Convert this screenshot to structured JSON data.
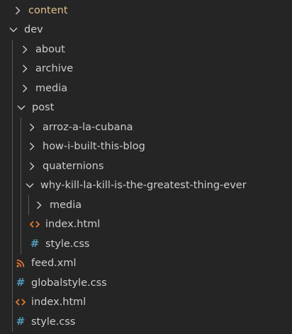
{
  "explorer": {
    "content": {
      "label": "content"
    },
    "dev": {
      "label": "dev",
      "about": "about",
      "archive": "archive",
      "media": "media",
      "post": {
        "label": "post",
        "arroz": "arroz-a-la-cubana",
        "blog": "how-i-built-this-blog",
        "quaternions": "quaternions",
        "killlakill": {
          "label": "why-kill-la-kill-is-the-greatest-thing-ever",
          "media": "media",
          "index": "index.html",
          "style": "style.css"
        }
      },
      "feed": "feed.xml",
      "globalstyle": "globalstyle.css",
      "index": "index.html",
      "style": "style.css"
    }
  },
  "colors": {
    "background": "#252526",
    "text": "#cccccc",
    "modified_folder": "#e2c08d",
    "html_icon": "#e37933",
    "css_icon": "#519aba",
    "rss_icon": "#e37933",
    "indent_guide": "#585858"
  },
  "icons": {
    "collapsed": "chevron-right-icon",
    "expanded": "chevron-down-icon",
    "html": "html-file-icon",
    "css": "css-file-icon",
    "xml": "rss-feed-icon"
  }
}
